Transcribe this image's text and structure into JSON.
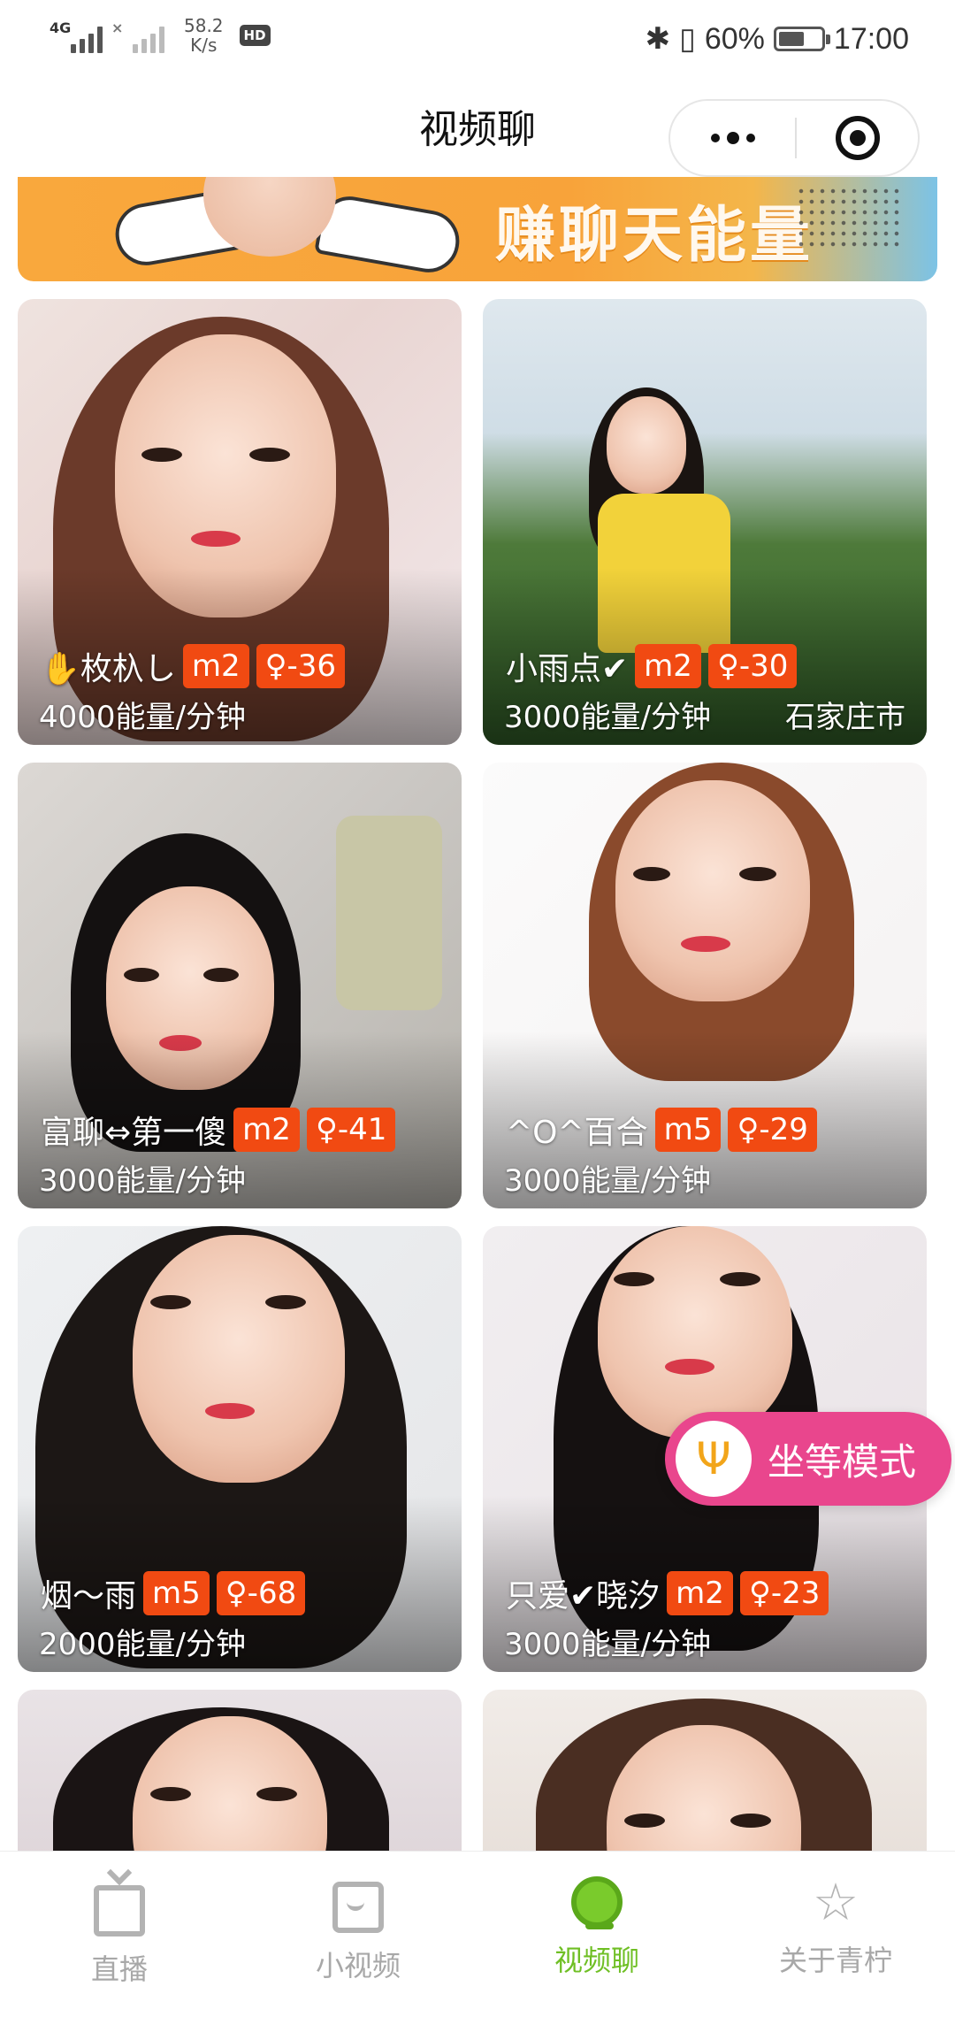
{
  "status_bar": {
    "net1": "4G",
    "net2": "×",
    "speed_value": "58.2",
    "speed_unit": "K/s",
    "hd": "HD",
    "battery_percent": "60%",
    "battery_level": 0.6,
    "time": "17:00"
  },
  "header": {
    "title": "视频聊"
  },
  "banner": {
    "text": "赚聊天能量"
  },
  "cards": [
    {
      "name": "✋枚杁し",
      "level": "m2",
      "age": "♀-36",
      "price": "4000能量/分钟",
      "location": ""
    },
    {
      "name": "小雨点✔",
      "level": "m2",
      "age": "♀-30",
      "price": "3000能量/分钟",
      "location": "石家庄市"
    },
    {
      "name": "富聊⇔第一傻",
      "level": "m2",
      "age": "♀-41",
      "price": "3000能量/分钟",
      "location": ""
    },
    {
      "name": "^O^百合",
      "level": "m5",
      "age": "♀-29",
      "price": "3000能量/分钟",
      "location": ""
    },
    {
      "name": "烟～雨",
      "level": "m5",
      "age": "♀-68",
      "price": "2000能量/分钟",
      "location": ""
    },
    {
      "name": "只爱✔晓汐",
      "level": "m2",
      "age": "♀-23",
      "price": "3000能量/分钟",
      "location": ""
    }
  ],
  "floating": {
    "wait_mode_label": "坐等模式",
    "icon": "trident-icon"
  },
  "tabs": [
    {
      "label": "直播",
      "icon": "tv-icon",
      "active": false
    },
    {
      "label": "小视频",
      "icon": "chat-icon",
      "active": false
    },
    {
      "label": "视频聊",
      "icon": "webcam-icon",
      "active": true
    },
    {
      "label": "关于青柠",
      "icon": "star-icon",
      "active": false
    }
  ],
  "colors": {
    "badge": "#f14a12",
    "active_tab": "#6fbf24",
    "wait_mode": "#e9468d"
  }
}
